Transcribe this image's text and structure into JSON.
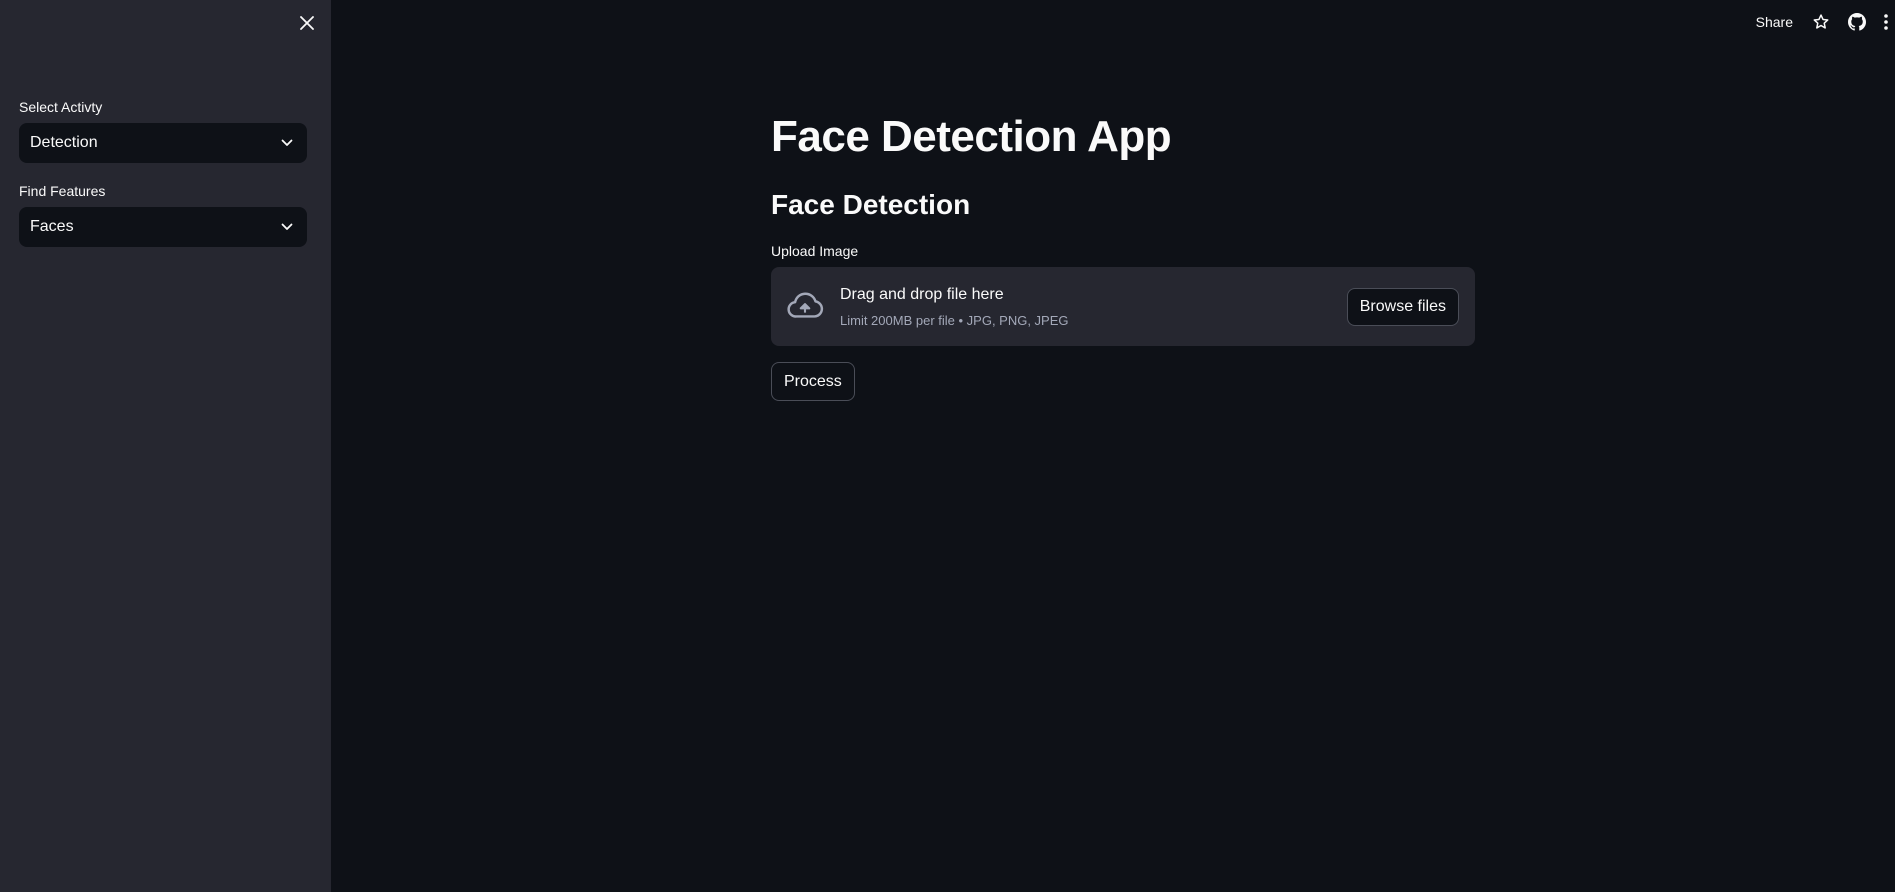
{
  "sidebar": {
    "close_icon": "close-icon",
    "activity": {
      "label": "Select Activty",
      "selected": "Detection"
    },
    "features": {
      "label": "Find Features",
      "selected": "Faces"
    }
  },
  "header": {
    "share_label": "Share",
    "icons": [
      "star-icon",
      "github-icon",
      "more-menu-icon"
    ]
  },
  "main": {
    "title": "Face Detection App",
    "section_title": "Face Detection",
    "uploader": {
      "label": "Upload Image",
      "drop_text": "Drag and drop file here",
      "limit_text": "Limit 200MB per file • JPG, PNG, JPEG",
      "browse_label": "Browse files"
    },
    "process_label": "Process"
  },
  "colors": {
    "background": "#0e1117",
    "sidebar": "#262730",
    "text": "#fafafa",
    "muted_text": "#a3a8b8"
  }
}
